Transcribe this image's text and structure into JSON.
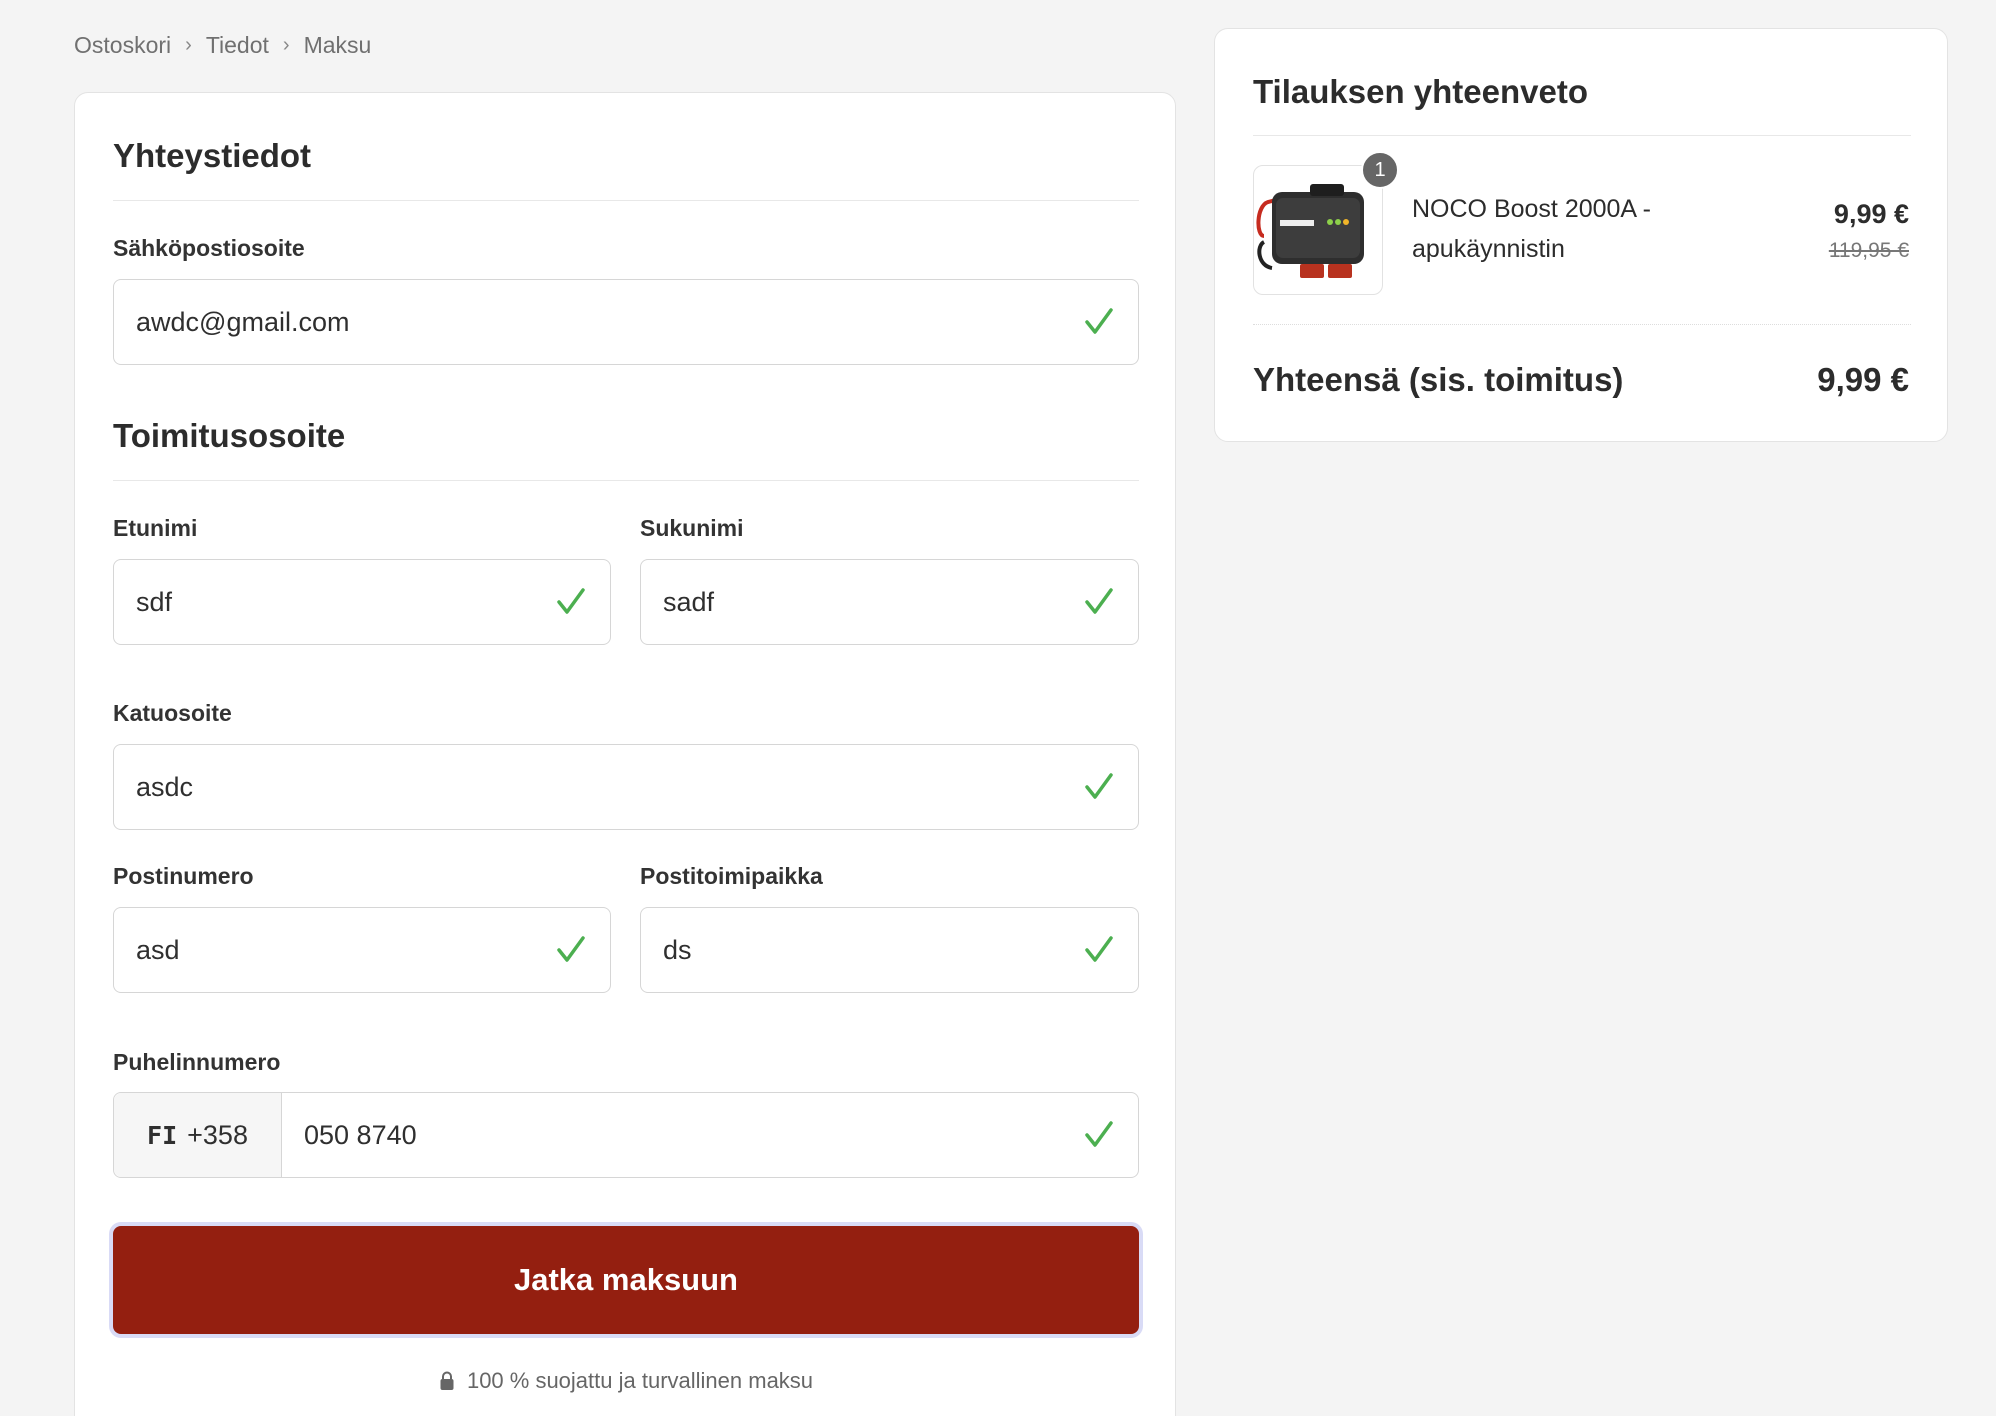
{
  "breadcrumb": [
    "Ostoskori",
    "Tiedot",
    "Maksu"
  ],
  "contact": {
    "title": "Yhteystiedot",
    "email_label": "Sähköpostiosoite",
    "email_value": "awdc@gmail.com"
  },
  "shipping": {
    "title": "Toimitusosoite",
    "first_name_label": "Etunimi",
    "first_name_value": "sdf",
    "last_name_label": "Sukunimi",
    "last_name_value": "sadf",
    "street_label": "Katuosoite",
    "street_value": "asdc",
    "postal_label": "Postinumero",
    "postal_value": "asd",
    "city_label": "Postitoimipaikka",
    "city_value": "ds",
    "phone_label": "Puhelinnumero",
    "phone_country": "FI",
    "phone_code": "+358",
    "phone_value": "050 8740"
  },
  "submit_label": "Jatka maksuun",
  "secure_note": "100 % suojattu ja turvallinen maksu",
  "summary": {
    "title": "Tilauksen yhteenveto",
    "item": {
      "quantity": "1",
      "name_line1": "NOCO Boost 2000A -",
      "name_line2": "apukäynnistin",
      "price": "9,99 €",
      "old_price": "119,95 €"
    },
    "total_label": "Yhteensä (sis. toimitus)",
    "total_value": "9,99 €"
  },
  "colors": {
    "accent": "#941f10",
    "check": "#4caf50",
    "background": "#f4f4f4"
  },
  "icons": [
    "checkmark-icon",
    "lock-icon",
    "chevron-right-icon"
  ]
}
